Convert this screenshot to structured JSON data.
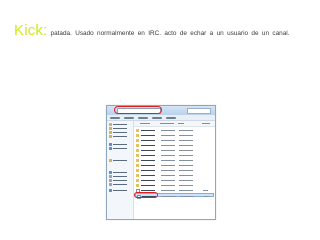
{
  "slide": {
    "title": "Kick:",
    "description": "patada. Usado normalmente en IRC. acto de  echar a un usuario de un canal."
  },
  "screenshot": {
    "window": "file-explorer",
    "nav_icons": [
      "star-icon",
      "folder-icon",
      "folder-icon",
      "folder-icon",
      "library-icon",
      "library-icon",
      "homegroup-icon",
      "computer-icon",
      "drive-icon",
      "drive-icon",
      "drive-icon",
      "network-icon"
    ],
    "file_rows": 14,
    "highlights": [
      "address-bar",
      "selected-file"
    ],
    "colors": {
      "highlight": "#e02020",
      "selection": "#cde3fb",
      "title": "#d0ea1a"
    }
  }
}
